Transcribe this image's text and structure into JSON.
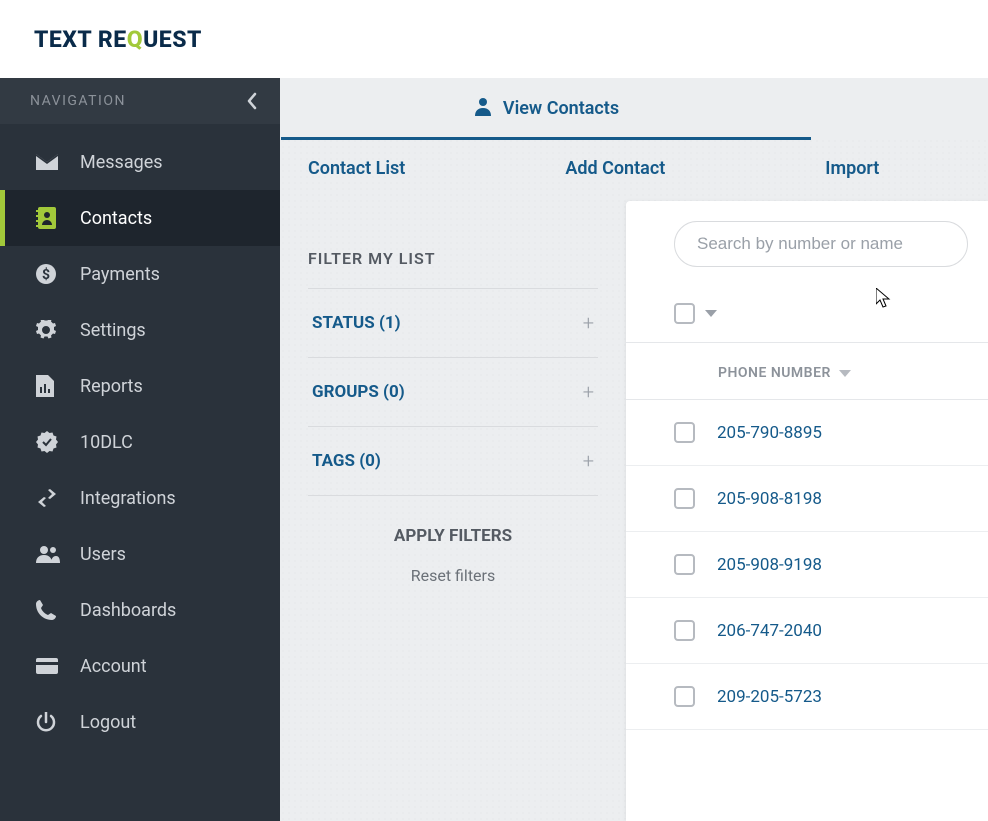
{
  "brand": {
    "text_pre": "TEXT RE",
    "text_q": "Q",
    "text_post": "UEST"
  },
  "sidebar": {
    "title": "NAVIGATION",
    "items": [
      {
        "label": "Messages"
      },
      {
        "label": "Contacts"
      },
      {
        "label": "Payments"
      },
      {
        "label": "Settings"
      },
      {
        "label": "Reports"
      },
      {
        "label": "10DLC"
      },
      {
        "label": "Integrations"
      },
      {
        "label": "Users"
      },
      {
        "label": "Dashboards"
      },
      {
        "label": "Account"
      },
      {
        "label": "Logout"
      }
    ]
  },
  "view_tab": "View Contacts",
  "sub_tabs": {
    "contact_list": "Contact List",
    "add_contact": "Add Contact",
    "import": "Import"
  },
  "filter": {
    "title": "FILTER MY LIST",
    "status": "STATUS (1)",
    "groups": "GROUPS (0)",
    "tags": "TAGS (0)",
    "apply": "APPLY FILTERS",
    "reset": "Reset filters"
  },
  "search": {
    "placeholder": "Search by number or name"
  },
  "column_header": "PHONE NUMBER",
  "contacts": [
    {
      "phone": "205-790-8895"
    },
    {
      "phone": "205-908-8198"
    },
    {
      "phone": "205-908-9198"
    },
    {
      "phone": "206-747-2040"
    },
    {
      "phone": "209-205-5723"
    }
  ]
}
